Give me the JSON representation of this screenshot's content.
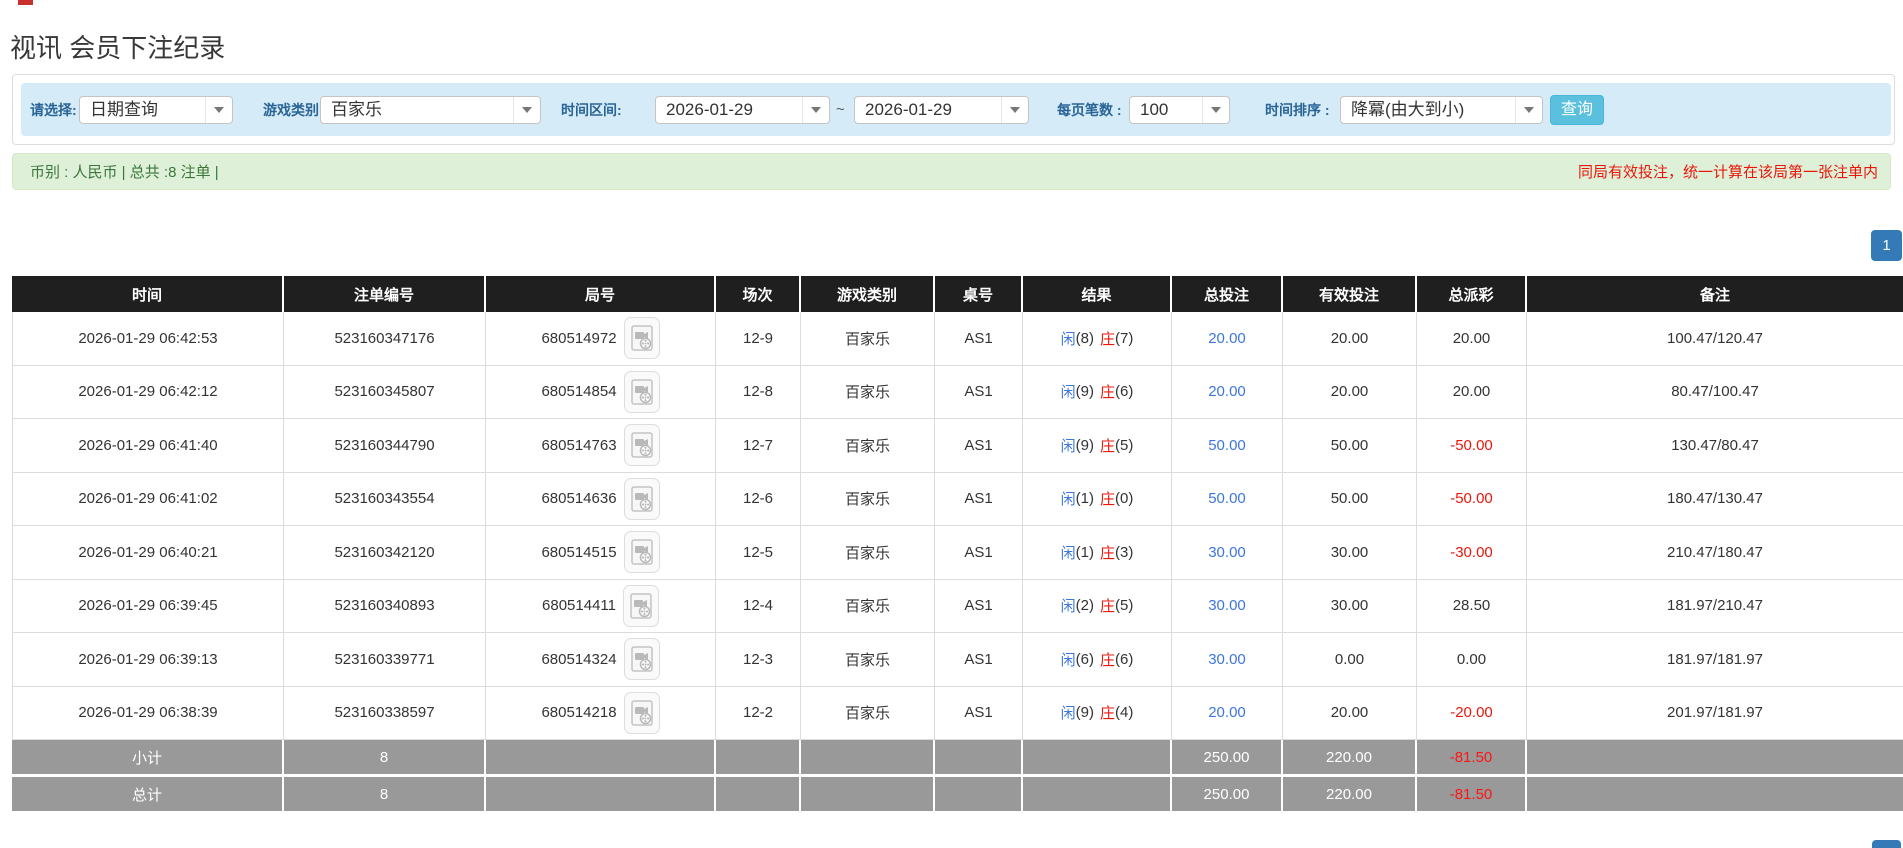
{
  "page": {
    "title": "视讯 会员下注纪录"
  },
  "filters": {
    "select_label": "请选择:",
    "select_value": "日期查询",
    "game_type_label": "游戏类别",
    "game_type_value": "百家乐",
    "time_range_label": "时间区间:",
    "date_from": "2026-01-29",
    "tilde": "~",
    "date_to": "2026-01-29",
    "page_size_label": "每页笔数 :",
    "page_size_value": "100",
    "sort_label": "时间排序 :",
    "sort_value": "降冪(由大到小)",
    "search_button": "查询"
  },
  "summary": {
    "left": "币别 : 人民币 | 总共 :8 注单 |",
    "right": "同局有效投注，统一计算在该局第一张注单内"
  },
  "pagination": {
    "page": "1"
  },
  "table": {
    "headers": [
      "时间",
      "注单编号",
      "局号",
      "场次",
      "游戏类别",
      "桌号",
      "结果",
      "总投注",
      "有效投注",
      "总派彩",
      "备注"
    ],
    "rows": [
      {
        "time": "2026-01-29 06:42:53",
        "bet_id": "523160347176",
        "round_id": "680514972",
        "session": "12-9",
        "game": "百家乐",
        "table_no": "AS1",
        "player": "闲",
        "player_pts": "(8)",
        "banker": "庄",
        "banker_pts": "(7)",
        "total_bet": "20.00",
        "valid_bet": "20.00",
        "payout": "20.00",
        "remark": "100.47/120.47"
      },
      {
        "time": "2026-01-29 06:42:12",
        "bet_id": "523160345807",
        "round_id": "680514854",
        "session": "12-8",
        "game": "百家乐",
        "table_no": "AS1",
        "player": "闲",
        "player_pts": "(9)",
        "banker": "庄",
        "banker_pts": "(6)",
        "total_bet": "20.00",
        "valid_bet": "20.00",
        "payout": "20.00",
        "remark": "80.47/100.47"
      },
      {
        "time": "2026-01-29 06:41:40",
        "bet_id": "523160344790",
        "round_id": "680514763",
        "session": "12-7",
        "game": "百家乐",
        "table_no": "AS1",
        "player": "闲",
        "player_pts": "(9)",
        "banker": "庄",
        "banker_pts": "(5)",
        "total_bet": "50.00",
        "valid_bet": "50.00",
        "payout": "-50.00",
        "remark": "130.47/80.47"
      },
      {
        "time": "2026-01-29 06:41:02",
        "bet_id": "523160343554",
        "round_id": "680514636",
        "session": "12-6",
        "game": "百家乐",
        "table_no": "AS1",
        "player": "闲",
        "player_pts": "(1)",
        "banker": "庄",
        "banker_pts": "(0)",
        "total_bet": "50.00",
        "valid_bet": "50.00",
        "payout": "-50.00",
        "remark": "180.47/130.47"
      },
      {
        "time": "2026-01-29 06:40:21",
        "bet_id": "523160342120",
        "round_id": "680514515",
        "session": "12-5",
        "game": "百家乐",
        "table_no": "AS1",
        "player": "闲",
        "player_pts": "(1)",
        "banker": "庄",
        "banker_pts": "(3)",
        "total_bet": "30.00",
        "valid_bet": "30.00",
        "payout": "-30.00",
        "remark": "210.47/180.47"
      },
      {
        "time": "2026-01-29 06:39:45",
        "bet_id": "523160340893",
        "round_id": "680514411",
        "session": "12-4",
        "game": "百家乐",
        "table_no": "AS1",
        "player": "闲",
        "player_pts": "(2)",
        "banker": "庄",
        "banker_pts": "(5)",
        "total_bet": "30.00",
        "valid_bet": "30.00",
        "payout": "28.50",
        "remark": "181.97/210.47"
      },
      {
        "time": "2026-01-29 06:39:13",
        "bet_id": "523160339771",
        "round_id": "680514324",
        "session": "12-3",
        "game": "百家乐",
        "table_no": "AS1",
        "player": "闲",
        "player_pts": "(6)",
        "banker": "庄",
        "banker_pts": "(6)",
        "total_bet": "30.00",
        "valid_bet": "0.00",
        "payout": "0.00",
        "remark": "181.97/181.97"
      },
      {
        "time": "2026-01-29 06:38:39",
        "bet_id": "523160338597",
        "round_id": "680514218",
        "session": "12-2",
        "game": "百家乐",
        "table_no": "AS1",
        "player": "闲",
        "player_pts": "(9)",
        "banker": "庄",
        "banker_pts": "(4)",
        "total_bet": "20.00",
        "valid_bet": "20.00",
        "payout": "-20.00",
        "remark": "201.97/181.97"
      }
    ],
    "subtotal": {
      "label": "小计",
      "count": "8",
      "total_bet": "250.00",
      "valid_bet": "220.00",
      "payout": "-81.50"
    },
    "total": {
      "label": "总计",
      "count": "8",
      "total_bet": "250.00",
      "valid_bet": "220.00",
      "payout": "-81.50"
    }
  }
}
